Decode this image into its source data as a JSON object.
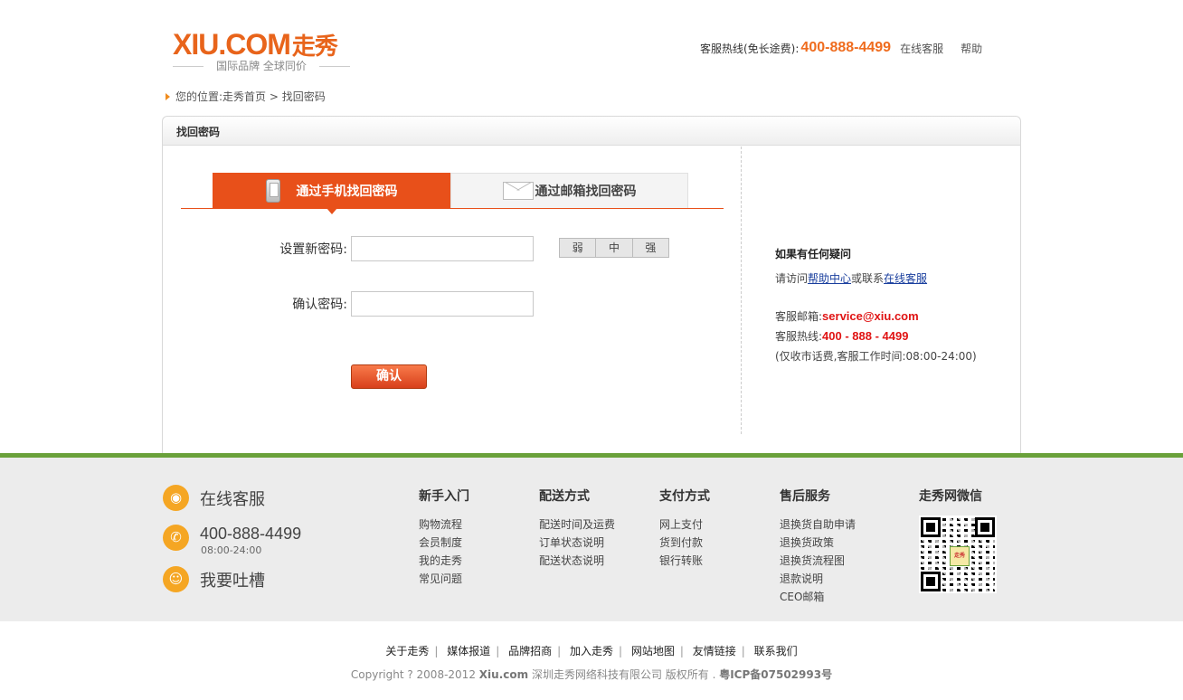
{
  "header": {
    "logo_brand": "XIU.COM",
    "logo_brand_cn": "走秀",
    "logo_slogan": "国际品牌  全球同价",
    "hotline_label": "客服热线(免长途费):",
    "hotline_number": "400-888-4499",
    "online_service": "在线客服",
    "help": "帮助"
  },
  "breadcrumb": {
    "prefix": "您的位置:",
    "home": "走秀首页",
    "sep": " > ",
    "current": "找回密码"
  },
  "box": {
    "title": "找回密码"
  },
  "tabs": [
    {
      "label": "通过手机找回密码",
      "active": true
    },
    {
      "label": "通过邮箱找回密码",
      "active": false
    }
  ],
  "form": {
    "new_password_label": "设置新密码:",
    "confirm_password_label": "确认密码:",
    "new_password_value": "",
    "confirm_password_value": "",
    "strength": [
      "弱",
      "中",
      "强"
    ],
    "submit_label": "确认"
  },
  "help": {
    "title": "如果有任何疑问",
    "visit_prefix": "请访问",
    "help_center": "帮助中心",
    "or_contact": "或联系",
    "online_service": "在线客服",
    "email_label": "客服邮箱:",
    "email": "service@xiu.com",
    "hotline_label": "客服热线:",
    "hotline": "400 - 888 - 4499",
    "note": "(仅收市话费,客服工作时间:08:00-24:00)"
  },
  "footer": {
    "services": {
      "online": "在线客服",
      "phone": "400-888-4499",
      "phone_hours": "08:00-24:00",
      "feedback": "我要吐槽"
    },
    "columns": [
      {
        "title": "新手入门",
        "links": [
          "购物流程",
          "会员制度",
          "我的走秀",
          "常见问题"
        ]
      },
      {
        "title": "配送方式",
        "links": [
          "配送时间及运费",
          "订单状态说明",
          "配送状态说明"
        ]
      },
      {
        "title": "支付方式",
        "links": [
          "网上支付",
          "货到付款",
          "银行转账"
        ]
      },
      {
        "title": "售后服务",
        "links": [
          "退换货自助申请",
          "退换货政策",
          "退换货流程图",
          "退款说明",
          "CEO邮箱"
        ]
      }
    ],
    "wechat_title": "走秀网微信",
    "qr_center_text": "走秀",
    "bottom_links": [
      "关于走秀",
      "媒体报道",
      "品牌招商",
      "加入走秀",
      "网站地图",
      "友情链接",
      "联系我们"
    ],
    "copyright_prefix": "Copyright ? 2008-2012",
    "copyright_site": "Xiu.com",
    "copyright_company": "深圳走秀网络科技有限公司 版权所有 .",
    "icp": "粤ICP备07502993号"
  },
  "colors": {
    "brand_orange": "#e8501a",
    "hotline_orange": "#ef6c1e",
    "footer_green": "#6aa13a",
    "help_red": "#e01414",
    "link_blue": "#1a3f9e"
  }
}
